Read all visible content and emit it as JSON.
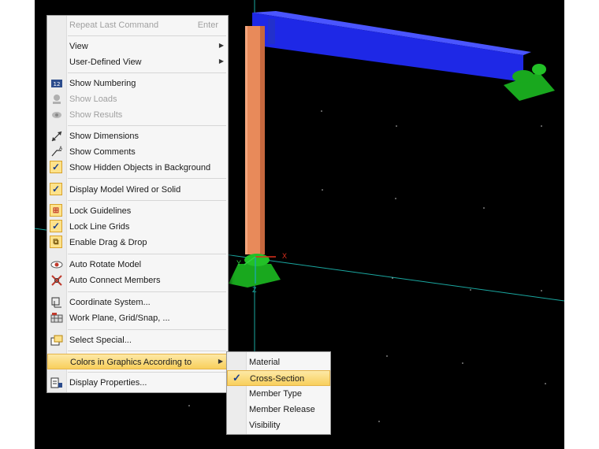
{
  "context_menu": {
    "items": [
      {
        "label": "Repeat Last Command",
        "shortcut": "Enter"
      },
      {
        "label": "View"
      },
      {
        "label": "User-Defined View"
      },
      {
        "label": "Show Numbering"
      },
      {
        "label": "Show Loads"
      },
      {
        "label": "Show Results"
      },
      {
        "label": "Show Dimensions"
      },
      {
        "label": "Show Comments"
      },
      {
        "label": "Show Hidden Objects in Background"
      },
      {
        "label": "Display Model Wired or Solid"
      },
      {
        "label": "Lock Guidelines"
      },
      {
        "label": "Lock Line Grids"
      },
      {
        "label": "Enable Drag & Drop"
      },
      {
        "label": "Auto Rotate Model"
      },
      {
        "label": "Auto Connect Members"
      },
      {
        "label": "Coordinate System..."
      },
      {
        "label": "Work Plane, Grid/Snap, ..."
      },
      {
        "label": "Select Special..."
      },
      {
        "label": "Colors in Graphics According to"
      },
      {
        "label": "Display Properties..."
      }
    ]
  },
  "submenu": {
    "items": [
      {
        "label": "Material"
      },
      {
        "label": "Cross-Section"
      },
      {
        "label": "Member Type"
      },
      {
        "label": "Member Release"
      },
      {
        "label": "Visibility"
      }
    ],
    "checked": "Cross-Section"
  },
  "axes": {
    "x": "X",
    "y": "Y",
    "z": "Z"
  },
  "icons": {
    "numbering": "numbering-icon",
    "loads": "loads-icon",
    "results": "results-icon",
    "dimensions": "dimension-icon",
    "comments": "comment-icon",
    "check": "check-icon",
    "auto_rotate": "eye-icon",
    "auto_connect": "connect-icon",
    "coordinate": "coordinate-system-icon",
    "work_plane": "grid-icon",
    "select_special": "select-icon",
    "display_props": "properties-icon"
  },
  "colors": {
    "viewport": "#000000",
    "beam": "#1e28e6",
    "column": "#e88a5a",
    "support": "#19a81e",
    "guide_line": "#1aa7a0",
    "highlight": "#f8cf5c"
  }
}
